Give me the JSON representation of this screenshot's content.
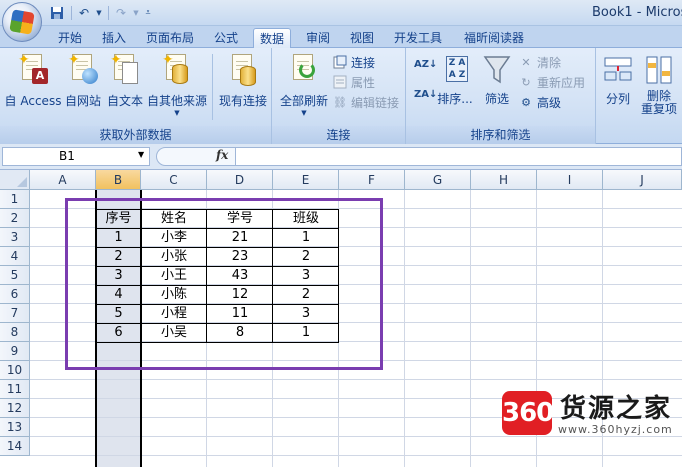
{
  "window": {
    "title": "Book1 - Micros"
  },
  "quick_access": {
    "icons": [
      "save-icon",
      "undo-icon",
      "redo-icon",
      "customize-icon"
    ]
  },
  "tabs": [
    {
      "label": "开始",
      "active": false
    },
    {
      "label": "插入",
      "active": false
    },
    {
      "label": "页面布局",
      "active": false
    },
    {
      "label": "公式",
      "active": false
    },
    {
      "label": "数据",
      "active": true
    },
    {
      "label": "审阅",
      "active": false
    },
    {
      "label": "视图",
      "active": false
    },
    {
      "label": "开发工具",
      "active": false
    },
    {
      "label": "福昕阅读器",
      "active": false
    }
  ],
  "ribbon": {
    "external": {
      "label": "获取外部数据",
      "buttons": [
        "自 Access",
        "自网站",
        "自文本",
        "自其他来源",
        "现有连接"
      ]
    },
    "connections": {
      "label": "连接",
      "refresh_all": "全部刷新",
      "small": [
        "连接",
        "属性",
        "编辑链接"
      ]
    },
    "sort_filter": {
      "label": "排序和筛选",
      "sort_asc": "AZ↓",
      "sort_desc": "ZA↓",
      "sort": "排序...",
      "filter": "筛选",
      "small": [
        "清除",
        "重新应用",
        "高级"
      ]
    },
    "tools": {
      "split": "分列",
      "remove_dup_1": "删除",
      "remove_dup_2": "重复项"
    }
  },
  "formula_bar": {
    "name_box": "B1",
    "fx": "fx",
    "value": ""
  },
  "grid": {
    "columns": [
      "A",
      "B",
      "C",
      "D",
      "E",
      "F",
      "G",
      "H",
      "I",
      "J"
    ],
    "selected_column": "B",
    "rows": [
      "1",
      "2",
      "3",
      "4",
      "5",
      "6",
      "7",
      "8",
      "9",
      "10",
      "11",
      "12",
      "13",
      "14"
    ]
  },
  "table": {
    "headers": [
      "序号",
      "姓名",
      "学号",
      "班级"
    ],
    "rows": [
      [
        "1",
        "小李",
        "21",
        "1"
      ],
      [
        "2",
        "小张",
        "23",
        "2"
      ],
      [
        "3",
        "小王",
        "43",
        "3"
      ],
      [
        "4",
        "小陈",
        "12",
        "2"
      ],
      [
        "5",
        "小程",
        "11",
        "3"
      ],
      [
        "6",
        "小吴",
        "8",
        "1"
      ]
    ]
  },
  "watermark": {
    "badge": "360",
    "brand": "货源之家",
    "url": "www.360hyzj.com"
  },
  "colors": {
    "highlight": "#7a3db0",
    "watermark_red": "#e11f24",
    "selected_header": "#f1c15f"
  }
}
